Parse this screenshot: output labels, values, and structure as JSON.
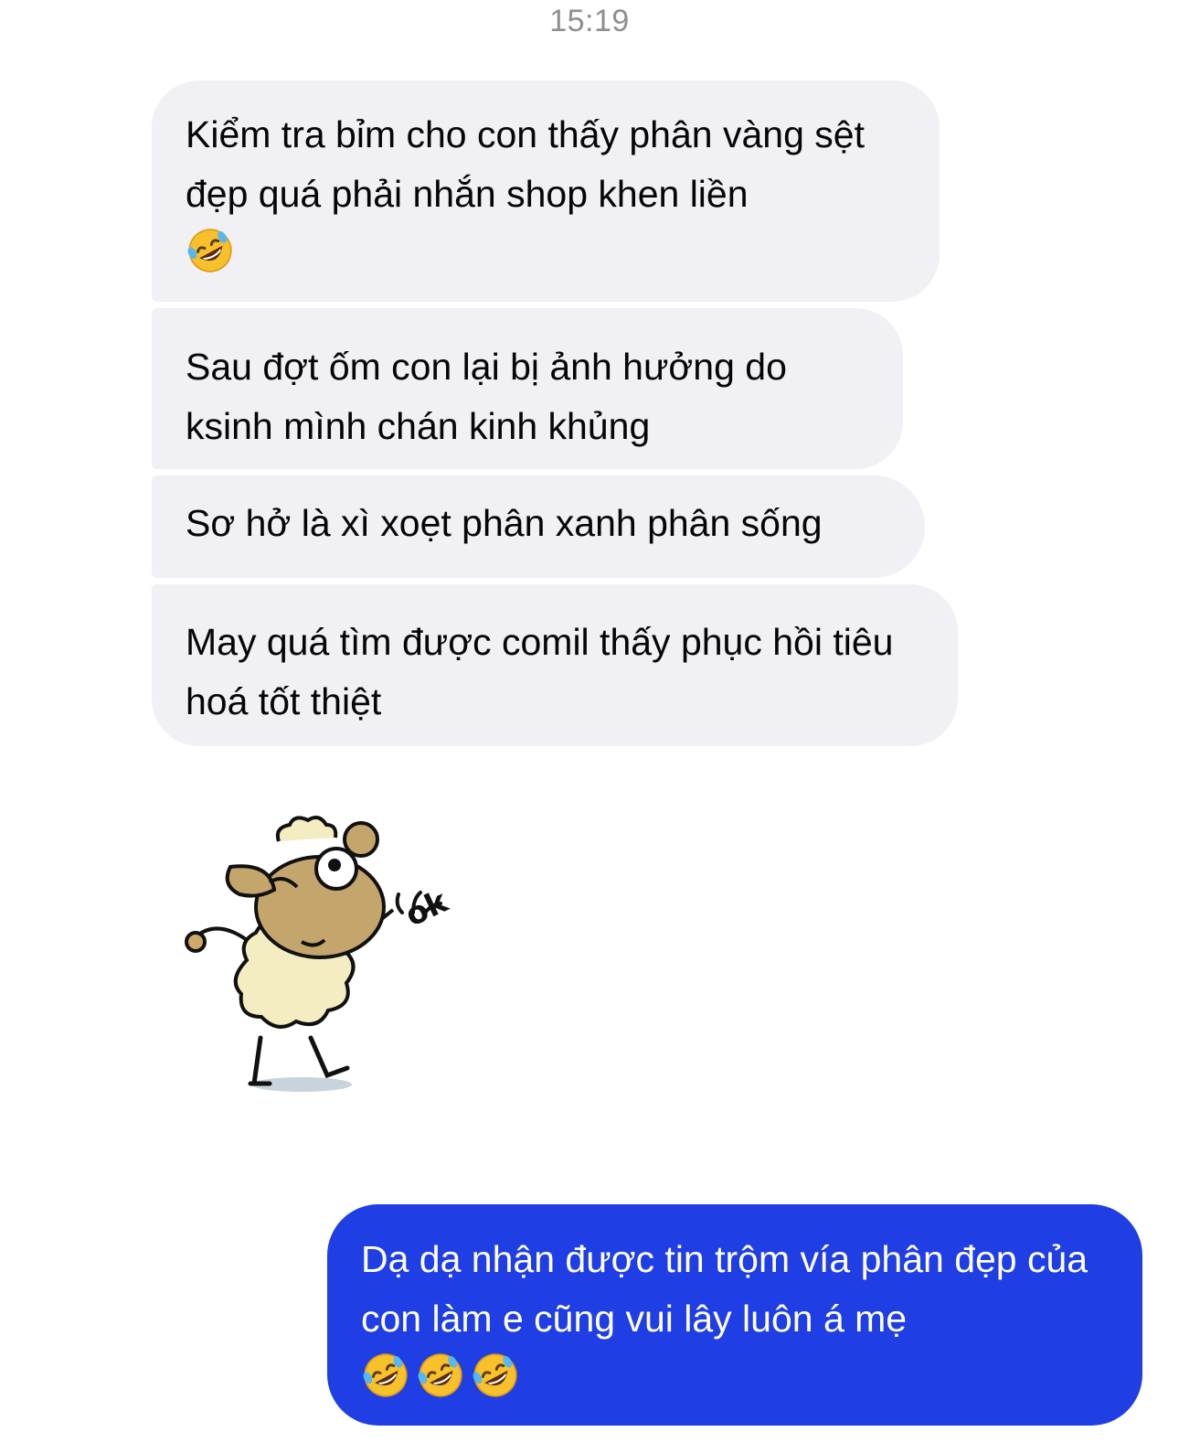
{
  "chat": {
    "timestamp": "15:19",
    "incoming": [
      {
        "text": "Kiểm tra bỉm cho con thấy phân vàng sệt đẹp quá phải nhắn shop khen liền",
        "emoji": "rolling-on-floor-laughing-emoji"
      },
      {
        "text": "Sau đợt ốm con lại bị ảnh hưởng do ksinh mình chán kinh khủng"
      },
      {
        "text": "Sơ hở là xì xoẹt phân xanh phân sống"
      },
      {
        "text": "May quá tìm được comil thấy phục hồi tiêu hoá tốt thiệt"
      }
    ],
    "sticker": {
      "icon": "sheep-ok-sticker",
      "text": "ok"
    },
    "outgoing": [
      {
        "text": "Dạ dạ nhận được tin trộm vía phân đẹp của con làm e cũng vui lây luôn á mẹ",
        "emoji_count": 3,
        "emoji": "rolling-on-floor-laughing-emoji"
      }
    ]
  },
  "colors": {
    "incoming_bubble": "#f0f0f5",
    "outgoing_bubble": "#1f3ee3",
    "timestamp": "#8e8e93"
  }
}
